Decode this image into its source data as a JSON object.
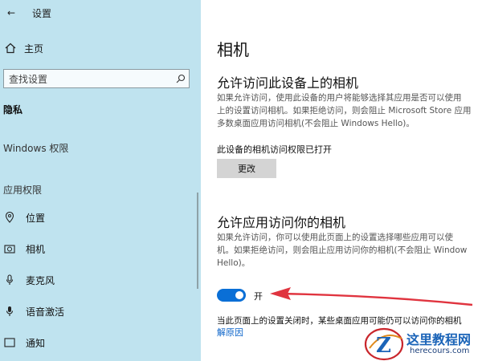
{
  "sidebar": {
    "back_icon": "back-arrow-icon",
    "title": "设置",
    "home": {
      "icon": "home-icon",
      "label": "主页"
    },
    "search": {
      "placeholder": "查找设置",
      "icon": "search-icon"
    },
    "privacy_heading": "隐私",
    "windows_permissions": "Windows 权限",
    "app_permissions": "应用权限",
    "items": [
      {
        "icon": "location-icon",
        "label": "位置"
      },
      {
        "icon": "camera-icon",
        "label": "相机"
      },
      {
        "icon": "microphone-icon",
        "label": "麦克风"
      },
      {
        "icon": "voice-activation-icon",
        "label": "语音激活"
      },
      {
        "icon": "notification-icon",
        "label": "通知"
      }
    ]
  },
  "main": {
    "title": "相机",
    "section1": {
      "heading": "允许访问此设备上的相机",
      "description": "如果允许访问，使用此设备的用户将能够选择其应用是否可以使用\n上的设置访问相机。如果拒绝访问，则会阻止 Microsoft Store 应用\n多数桌面应用访问相机(不会阻止 Windows Hello)。",
      "status": "此设备的相机访问权限已打开",
      "change_button": "更改"
    },
    "section2": {
      "heading": "允许应用访问你的相机",
      "description": "如果允许访问，你可以使用此页面上的设置选择哪些应用可以使\n机。如果拒绝访问，则会阻止应用访问你的相机(不会阻止 Window\nHello)。",
      "toggle_state": "on",
      "toggle_label": "开",
      "note": "当此页面上的设置关闭时，某些桌面应用可能仍可以访问你的相机",
      "link": "解原因"
    }
  },
  "watermark": {
    "title": "这里教程网",
    "url": "herecours.com"
  },
  "colors": {
    "sidebar_bg": "#bfe3ef",
    "accent": "#0a6fd6",
    "link": "#0a63c9",
    "annotation_arrow": "#e0343f"
  }
}
